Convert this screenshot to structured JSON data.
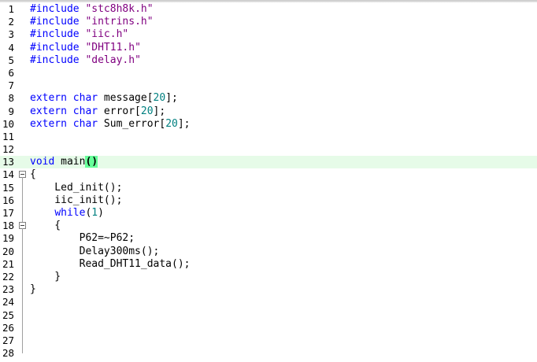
{
  "editor": {
    "lines": [
      {
        "n": "1",
        "parts": [
          [
            "pp",
            "#include "
          ],
          [
            "str",
            "\"stc8h8k.h\""
          ]
        ]
      },
      {
        "n": "2",
        "parts": [
          [
            "pp",
            "#include "
          ],
          [
            "str",
            "\"intrins.h\""
          ]
        ]
      },
      {
        "n": "3",
        "parts": [
          [
            "pp",
            "#include "
          ],
          [
            "str",
            "\"iic.h\""
          ]
        ]
      },
      {
        "n": "4",
        "parts": [
          [
            "pp",
            "#include "
          ],
          [
            "str",
            "\"DHT11.h\""
          ]
        ]
      },
      {
        "n": "5",
        "parts": [
          [
            "pp",
            "#include "
          ],
          [
            "str",
            "\"delay.h\""
          ]
        ]
      },
      {
        "n": "6",
        "parts": []
      },
      {
        "n": "7",
        "parts": []
      },
      {
        "n": "8",
        "parts": [
          [
            "kw",
            "extern char"
          ],
          [
            "",
            " message["
          ],
          [
            "num",
            "20"
          ],
          [
            "",
            "];"
          ]
        ]
      },
      {
        "n": "9",
        "parts": [
          [
            "kw",
            "extern char"
          ],
          [
            "",
            " error["
          ],
          [
            "num",
            "20"
          ],
          [
            "",
            "];"
          ]
        ]
      },
      {
        "n": "10",
        "parts": [
          [
            "kw",
            "extern char"
          ],
          [
            "",
            " Sum_error["
          ],
          [
            "num",
            "20"
          ],
          [
            "",
            "];"
          ]
        ]
      },
      {
        "n": "11",
        "parts": []
      },
      {
        "n": "12",
        "parts": []
      },
      {
        "n": "13",
        "parts": [
          [
            "kw",
            "void"
          ],
          [
            "",
            " main"
          ],
          [
            "hl",
            "()"
          ]
        ],
        "current": true
      },
      {
        "n": "14",
        "parts": [
          [
            "",
            "{"
          ]
        ],
        "fold": "start"
      },
      {
        "n": "15",
        "parts": [
          [
            "",
            "    Led_init();"
          ]
        ],
        "fold": "mid"
      },
      {
        "n": "16",
        "parts": [
          [
            "",
            "    iic_init();"
          ]
        ],
        "fold": "mid"
      },
      {
        "n": "17",
        "parts": [
          [
            "",
            "    "
          ],
          [
            "kw",
            "while"
          ],
          [
            "",
            "("
          ],
          [
            "num",
            "1"
          ],
          [
            "",
            ")"
          ]
        ],
        "fold": "mid"
      },
      {
        "n": "18",
        "parts": [
          [
            "",
            "    {"
          ]
        ],
        "fold": "start2"
      },
      {
        "n": "19",
        "parts": [
          [
            "",
            "        P62=~P62;"
          ]
        ],
        "fold": "mid"
      },
      {
        "n": "20",
        "parts": [
          [
            "",
            "        Delay300ms();"
          ]
        ],
        "fold": "mid"
      },
      {
        "n": "21",
        "parts": [
          [
            "",
            "        Read_DHT11_data();"
          ]
        ],
        "fold": "mid"
      },
      {
        "n": "22",
        "parts": [
          [
            "",
            "    }"
          ]
        ],
        "fold": "end"
      },
      {
        "n": "23",
        "parts": [
          [
            "",
            "}"
          ]
        ],
        "fold": "mid"
      },
      {
        "n": "24",
        "parts": []
      },
      {
        "n": "25",
        "parts": []
      },
      {
        "n": "26",
        "parts": []
      },
      {
        "n": "27",
        "parts": []
      },
      {
        "n": "28",
        "parts": []
      }
    ]
  },
  "colors": {
    "keyword": "#0000ff",
    "string": "#800080",
    "number": "#008080",
    "current_line": "#e6fbe8",
    "brace_match": "#66ff99"
  }
}
